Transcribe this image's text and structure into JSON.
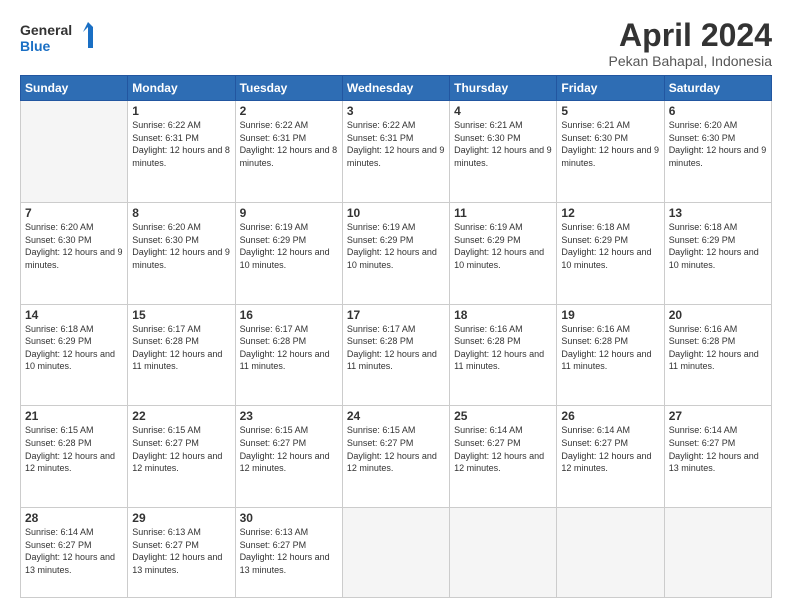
{
  "logo": {
    "line1": "General",
    "line2": "Blue"
  },
  "title": "April 2024",
  "subtitle": "Pekan Bahapal, Indonesia",
  "days_header": [
    "Sunday",
    "Monday",
    "Tuesday",
    "Wednesday",
    "Thursday",
    "Friday",
    "Saturday"
  ],
  "weeks": [
    [
      {
        "day": "",
        "sunrise": "",
        "sunset": "",
        "daylight": ""
      },
      {
        "day": "1",
        "sunrise": "6:22 AM",
        "sunset": "6:31 PM",
        "daylight": "12 hours and 8 minutes."
      },
      {
        "day": "2",
        "sunrise": "6:22 AM",
        "sunset": "6:31 PM",
        "daylight": "12 hours and 8 minutes."
      },
      {
        "day": "3",
        "sunrise": "6:22 AM",
        "sunset": "6:31 PM",
        "daylight": "12 hours and 9 minutes."
      },
      {
        "day": "4",
        "sunrise": "6:21 AM",
        "sunset": "6:30 PM",
        "daylight": "12 hours and 9 minutes."
      },
      {
        "day": "5",
        "sunrise": "6:21 AM",
        "sunset": "6:30 PM",
        "daylight": "12 hours and 9 minutes."
      },
      {
        "day": "6",
        "sunrise": "6:20 AM",
        "sunset": "6:30 PM",
        "daylight": "12 hours and 9 minutes."
      }
    ],
    [
      {
        "day": "7",
        "sunrise": "6:20 AM",
        "sunset": "6:30 PM",
        "daylight": "12 hours and 9 minutes."
      },
      {
        "day": "8",
        "sunrise": "6:20 AM",
        "sunset": "6:30 PM",
        "daylight": "12 hours and 9 minutes."
      },
      {
        "day": "9",
        "sunrise": "6:19 AM",
        "sunset": "6:29 PM",
        "daylight": "12 hours and 10 minutes."
      },
      {
        "day": "10",
        "sunrise": "6:19 AM",
        "sunset": "6:29 PM",
        "daylight": "12 hours and 10 minutes."
      },
      {
        "day": "11",
        "sunrise": "6:19 AM",
        "sunset": "6:29 PM",
        "daylight": "12 hours and 10 minutes."
      },
      {
        "day": "12",
        "sunrise": "6:18 AM",
        "sunset": "6:29 PM",
        "daylight": "12 hours and 10 minutes."
      },
      {
        "day": "13",
        "sunrise": "6:18 AM",
        "sunset": "6:29 PM",
        "daylight": "12 hours and 10 minutes."
      }
    ],
    [
      {
        "day": "14",
        "sunrise": "6:18 AM",
        "sunset": "6:29 PM",
        "daylight": "12 hours and 10 minutes."
      },
      {
        "day": "15",
        "sunrise": "6:17 AM",
        "sunset": "6:28 PM",
        "daylight": "12 hours and 11 minutes."
      },
      {
        "day": "16",
        "sunrise": "6:17 AM",
        "sunset": "6:28 PM",
        "daylight": "12 hours and 11 minutes."
      },
      {
        "day": "17",
        "sunrise": "6:17 AM",
        "sunset": "6:28 PM",
        "daylight": "12 hours and 11 minutes."
      },
      {
        "day": "18",
        "sunrise": "6:16 AM",
        "sunset": "6:28 PM",
        "daylight": "12 hours and 11 minutes."
      },
      {
        "day": "19",
        "sunrise": "6:16 AM",
        "sunset": "6:28 PM",
        "daylight": "12 hours and 11 minutes."
      },
      {
        "day": "20",
        "sunrise": "6:16 AM",
        "sunset": "6:28 PM",
        "daylight": "12 hours and 11 minutes."
      }
    ],
    [
      {
        "day": "21",
        "sunrise": "6:15 AM",
        "sunset": "6:28 PM",
        "daylight": "12 hours and 12 minutes."
      },
      {
        "day": "22",
        "sunrise": "6:15 AM",
        "sunset": "6:27 PM",
        "daylight": "12 hours and 12 minutes."
      },
      {
        "day": "23",
        "sunrise": "6:15 AM",
        "sunset": "6:27 PM",
        "daylight": "12 hours and 12 minutes."
      },
      {
        "day": "24",
        "sunrise": "6:15 AM",
        "sunset": "6:27 PM",
        "daylight": "12 hours and 12 minutes."
      },
      {
        "day": "25",
        "sunrise": "6:14 AM",
        "sunset": "6:27 PM",
        "daylight": "12 hours and 12 minutes."
      },
      {
        "day": "26",
        "sunrise": "6:14 AM",
        "sunset": "6:27 PM",
        "daylight": "12 hours and 12 minutes."
      },
      {
        "day": "27",
        "sunrise": "6:14 AM",
        "sunset": "6:27 PM",
        "daylight": "12 hours and 13 minutes."
      }
    ],
    [
      {
        "day": "28",
        "sunrise": "6:14 AM",
        "sunset": "6:27 PM",
        "daylight": "12 hours and 13 minutes."
      },
      {
        "day": "29",
        "sunrise": "6:13 AM",
        "sunset": "6:27 PM",
        "daylight": "12 hours and 13 minutes."
      },
      {
        "day": "30",
        "sunrise": "6:13 AM",
        "sunset": "6:27 PM",
        "daylight": "12 hours and 13 minutes."
      },
      {
        "day": "",
        "sunrise": "",
        "sunset": "",
        "daylight": ""
      },
      {
        "day": "",
        "sunrise": "",
        "sunset": "",
        "daylight": ""
      },
      {
        "day": "",
        "sunrise": "",
        "sunset": "",
        "daylight": ""
      },
      {
        "day": "",
        "sunrise": "",
        "sunset": "",
        "daylight": ""
      }
    ]
  ],
  "labels": {
    "sunrise_prefix": "Sunrise: ",
    "sunset_prefix": "Sunset: ",
    "daylight_prefix": "Daylight: "
  }
}
